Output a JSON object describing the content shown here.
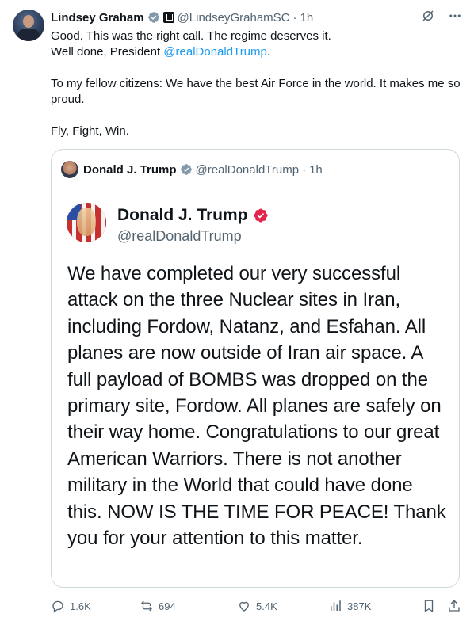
{
  "tweet": {
    "author_name": "Lindsey Graham",
    "author_handle": "@LindseyGrahamSC",
    "separator": "·",
    "time": "1h",
    "lines": [
      "Good. This was the right call. The regime deserves it.",
      "Well done, President ",
      "@realDonaldTrump",
      ".",
      "To my fellow citizens: We have the best Air Force in the world. It makes me so proud.",
      "Fly, Fight, Win."
    ]
  },
  "quote": {
    "author_name": "Donald J. Trump",
    "author_handle": "@realDonaldTrump",
    "separator": "·",
    "time": "1h",
    "image": {
      "name": "Donald J. Trump",
      "handle": "@realDonaldTrump",
      "text": "We have completed our very successful attack on the three Nuclear sites in Iran, including Fordow, Natanz, and Esfahan. All planes are now outside of Iran air space. A full payload of BOMBS was dropped on the primary site, Fordow. All planes are safely on their way home. Congratulations to our great American Warriors. There is not another military in the World that could have done this. NOW IS THE TIME FOR PEACE! Thank you for your attention to this matter."
    }
  },
  "actions": {
    "replies": "1.6K",
    "reposts": "694",
    "likes": "5.4K",
    "views": "387K"
  },
  "colors": {
    "text": "#0f1419",
    "muted": "#536471",
    "link": "#1d9bf0",
    "border": "#cfd9de",
    "verified_blue": "#1d9bf0",
    "verified_gold": "#e2264d"
  }
}
